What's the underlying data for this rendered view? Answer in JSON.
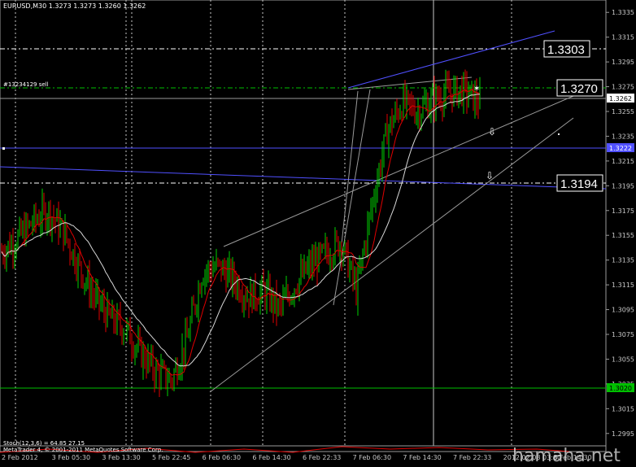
{
  "header": {
    "text": "EURUSD,M30  1.3273 1.3273 1.3260 1.3262"
  },
  "order_label": "#13234129 sell",
  "indicator_label": "Stoch(12,3,6) = 64.85 27.15",
  "copyright": "MetaTrader 4, © 2001-2011 MetaQuotes Software Corp.",
  "watermark": "hamaha.net",
  "price_axis": {
    "ticks": [
      "1.3335",
      "1.3315",
      "1.3295",
      "1.3275",
      "1.3255",
      "1.3235",
      "1.3215",
      "1.3195",
      "1.3175",
      "1.3155",
      "1.3135",
      "1.3115",
      "1.3095",
      "1.3075",
      "1.3055",
      "1.3035",
      "1.3015",
      "1.2995"
    ]
  },
  "time_axis": {
    "ticks": [
      "2 Feb 2012",
      "3 Feb 05:30",
      "3 Feb 13:30",
      "5 Feb 22:45",
      "6 Feb 06:30",
      "6 Feb 14:30",
      "6 Feb 22:33",
      "7 Feb 06:30",
      "7 Feb 14:30",
      "7 Feb 22:33",
      "2012.02.08 03:00",
      "8 Feb 14:30"
    ]
  },
  "levels": {
    "l1": "1.3303",
    "l2": "1.3270",
    "l3": "1.3194"
  },
  "tags": {
    "current_price": "1.3262",
    "blue_line": "1.3222",
    "green_line": "1.3020"
  },
  "colors": {
    "bull": "#00d000",
    "bear": "#e00000",
    "ma_fast": "#e00000",
    "ma_slow": "#d8d8d8",
    "channel": "#5050ff",
    "trend": "#9a9a9a"
  },
  "chart_data": {
    "type": "candlestick",
    "symbol": "EURUSD",
    "timeframe": "M30",
    "last_bar": {
      "open": 1.3273,
      "high": 1.3273,
      "low": 1.326,
      "close": 1.3262
    },
    "ylim": [
      1.2985,
      1.3345
    ],
    "approximate_path": [
      1.3142,
      1.3152,
      1.3165,
      1.3175,
      1.3158,
      1.313,
      1.3105,
      1.3088,
      1.308,
      1.306,
      1.3045,
      1.3038,
      1.307,
      1.3125,
      1.313,
      1.312,
      1.3105,
      1.311,
      1.3095,
      1.3115,
      1.313,
      1.314,
      1.315,
      1.311,
      1.318,
      1.324,
      1.3262,
      1.3255,
      1.3265,
      1.327,
      1.3272,
      1.3262
    ]
  }
}
